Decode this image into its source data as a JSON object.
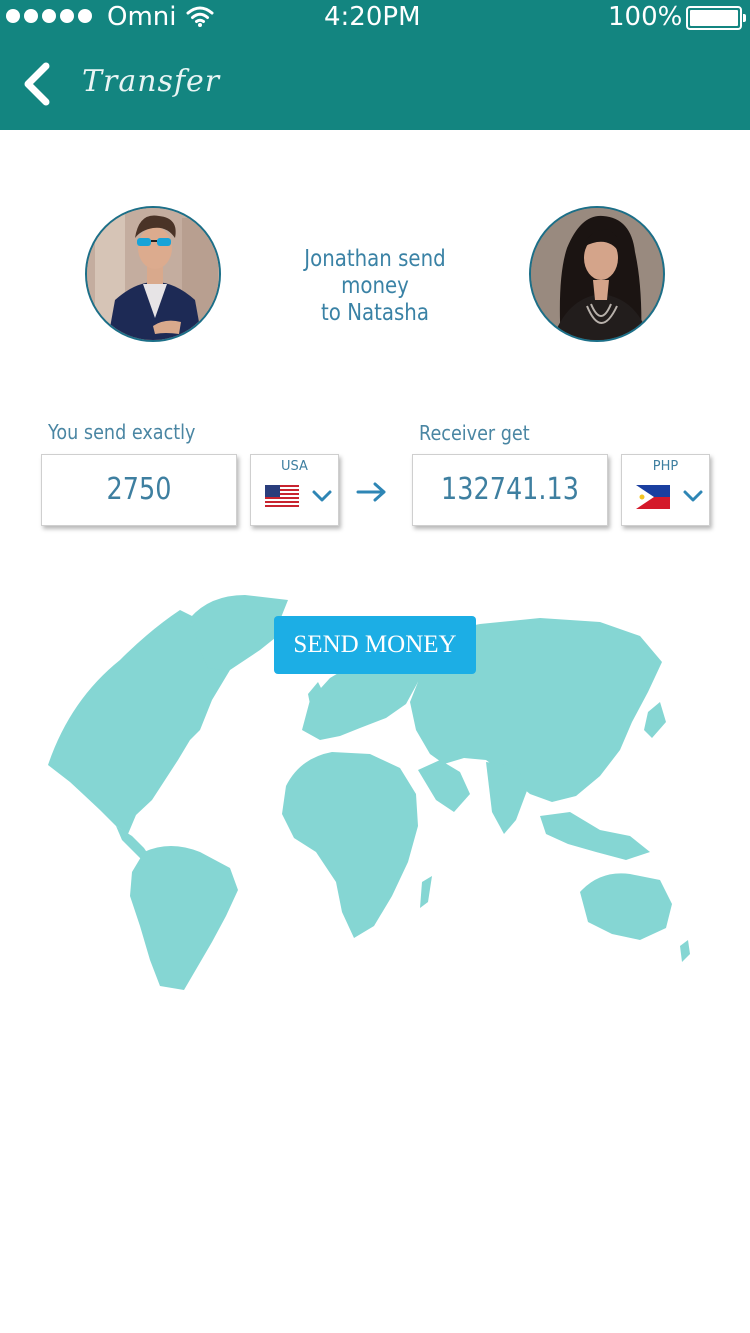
{
  "status_bar": {
    "carrier": "Omni",
    "time": "4:20PM",
    "battery": "100%"
  },
  "nav": {
    "title": "Transfer"
  },
  "transfer": {
    "caption_line1": "Jonathan send money",
    "caption_line2": "to Natasha",
    "sender_name": "Jonathan",
    "receiver_name": "Natasha"
  },
  "send": {
    "label": "You send exactly",
    "amount": "2750",
    "currency_code": "USA",
    "flag": "us-flag-icon"
  },
  "receive": {
    "label": "Receiver get",
    "amount": "132741.13",
    "currency_code": "PHP",
    "flag": "ph-flag-icon"
  },
  "actions": {
    "send_money": "SEND MONEY"
  },
  "colors": {
    "header": "#138580",
    "accent_text": "#3e7fa0",
    "button": "#1caee5",
    "map": "#85d6d3"
  }
}
